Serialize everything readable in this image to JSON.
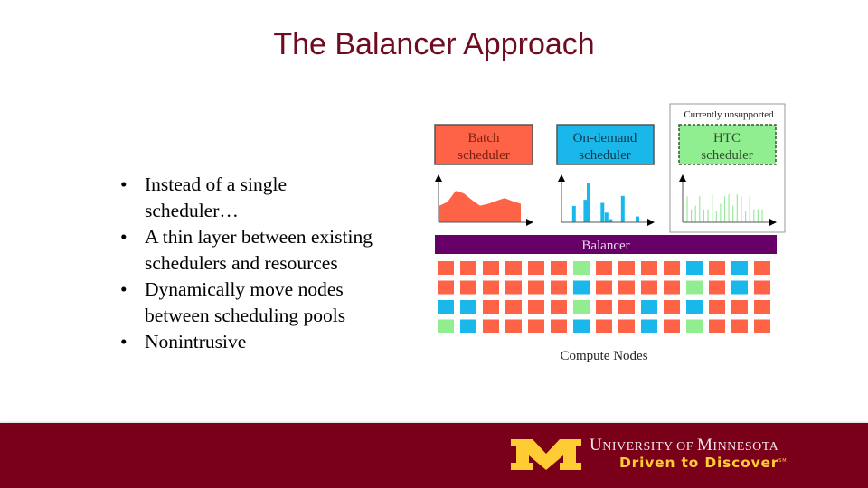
{
  "slide": {
    "title": "The Balancer Approach",
    "bullet_char": "•",
    "bullets": [
      {
        "line1": "Instead of a single",
        "line2": "scheduler…"
      },
      {
        "line1": "A thin layer between existing",
        "line2": "schedulers and resources"
      },
      {
        "line1": "Dynamically move nodes",
        "line2": "between scheduling pools"
      },
      {
        "line1": "Nonintrusive",
        "line2": ""
      }
    ]
  },
  "diagram": {
    "schedulers": [
      {
        "id": "batch",
        "line1": "Batch",
        "line2": "scheduler",
        "color": "#ff6347",
        "text_color": "#7a1e10"
      },
      {
        "id": "on-demand",
        "line1": "On-demand",
        "line2": "scheduler",
        "color": "#1ab8ea",
        "text_color": "#0a3850"
      },
      {
        "id": "htc",
        "line1": "HTC",
        "line2": "scheduler",
        "color": "#90ee90",
        "text_color": "#2f4f2f"
      }
    ],
    "htc_note": "Currently unsupported",
    "balancer_label": "Balancer",
    "balancer_color": "#660066",
    "compute_nodes_label": "Compute Nodes",
    "node_colors": {
      "R": "#ff6347",
      "B": "#1ab8ea",
      "G": "#90ee90"
    },
    "node_grid": [
      "RRRRRRGRRRRBRBR",
      "RRRRRRBRRRRGRBR",
      "BBRRRRGRRBRBRRR",
      "GBRRRRBRRBRGRRR"
    ],
    "batch_load": [
      0.45,
      0.55,
      0.85,
      0.78,
      0.6,
      0.45,
      0.5,
      0.58,
      0.65,
      0.57,
      0.5
    ],
    "ondemand_bars": [
      {
        "x": 0.12,
        "h": 0.42
      },
      {
        "x": 0.26,
        "h": 0.58
      },
      {
        "x": 0.3,
        "h": 1.0
      },
      {
        "x": 0.47,
        "h": 0.5
      },
      {
        "x": 0.52,
        "h": 0.25
      },
      {
        "x": 0.57,
        "h": 0.08
      },
      {
        "x": 0.72,
        "h": 0.68
      },
      {
        "x": 0.9,
        "h": 0.15
      }
    ],
    "htc_spikes": [
      0.7,
      0.35,
      0.45,
      0.7,
      0.35,
      0.35,
      0.75,
      0.3,
      0.5,
      0.7,
      0.75,
      0.45,
      0.75,
      0.7,
      0.3,
      0.7,
      0.35,
      0.35,
      0.35
    ]
  },
  "footer": {
    "university_first": "U",
    "university_rest1": "NIVERSITY OF ",
    "university_m": "M",
    "university_rest2": "INNESOTA",
    "tagline": "Driven to Discover",
    "tagline_mark": "SM",
    "band_color": "#7a0019",
    "gold": "#ffcc33"
  }
}
